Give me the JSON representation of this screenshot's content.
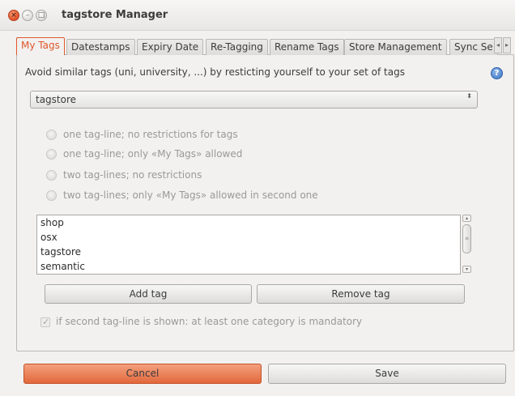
{
  "window": {
    "title": "tagstore Manager",
    "close_glyph": "×",
    "min_glyph": "–",
    "max_glyph": "□"
  },
  "tabs": [
    {
      "label": "My Tags",
      "active": true
    },
    {
      "label": "Datestamps",
      "active": false
    },
    {
      "label": "Expiry Date",
      "active": false
    },
    {
      "label": "Re-Tagging",
      "active": false
    },
    {
      "label": "Rename Tags",
      "active": false
    },
    {
      "label": "Store Management",
      "active": false
    },
    {
      "label": "Sync Se",
      "active": false
    }
  ],
  "tab_scroll": {
    "left_glyph": "◂",
    "right_glyph": "▸"
  },
  "my_tags": {
    "intro": "Avoid similar tags (uni, university, ...) by resticting yourself to your set of tags",
    "help_glyph": "?",
    "store_combo": {
      "value": "tagstore",
      "arrows_glyph": "⬍"
    },
    "options": [
      {
        "label": "one tag-line; no restrictions for tags",
        "enabled": false
      },
      {
        "label": "one tag-line; only «My Tags» allowed",
        "enabled": false
      },
      {
        "label": "two tag-lines; no restrictions",
        "enabled": false
      },
      {
        "label": "two tag-lines; only «My Tags» allowed in second one",
        "enabled": false
      }
    ],
    "tags": [
      "shop",
      "osx",
      "tagstore",
      "semantic"
    ],
    "add_tag_label": "Add tag",
    "remove_tag_label": "Remove tag",
    "mandatory_label": "if second tag-line is shown: at least one category is mandatory",
    "mandatory_checked": true
  },
  "footer": {
    "cancel_label": "Cancel",
    "save_label": "Save"
  },
  "colors": {
    "accent": "#e0572b",
    "primary_button": "#e2683c",
    "window_bg": "#f2f1f0"
  }
}
